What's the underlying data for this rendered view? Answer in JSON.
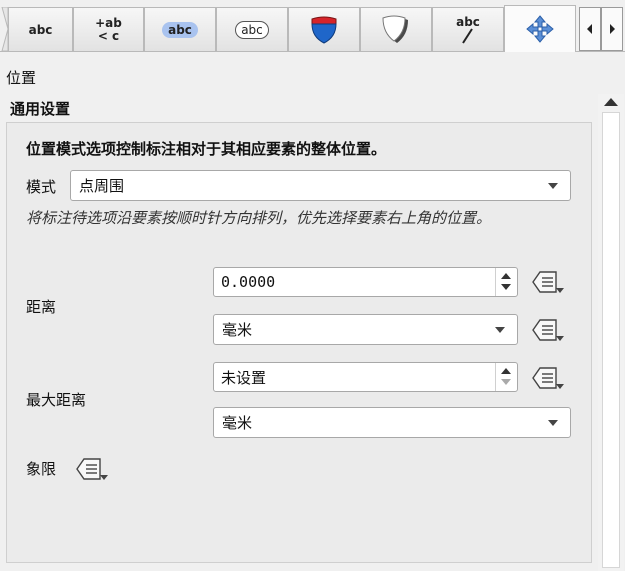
{
  "tabs": [
    {
      "name": "text",
      "label": "abc"
    },
    {
      "name": "formatting",
      "label_top": "+ab",
      "label_bottom": "< c"
    },
    {
      "name": "buffer",
      "label": "abc"
    },
    {
      "name": "mask",
      "label": "abc"
    },
    {
      "name": "background-shield",
      "icon": "interstate-shield-icon"
    },
    {
      "name": "shadow",
      "icon": "shadow-shield-icon"
    },
    {
      "name": "callouts",
      "label": "abc",
      "icon": "callout-line-icon"
    },
    {
      "name": "placement",
      "icon": "move-arrows-icon",
      "active": true
    }
  ],
  "section_title": "位置",
  "group_title": "通用设置",
  "description": "位置模式选项控制标注相对于其相应要素的整体位置。",
  "mode": {
    "label": "模式",
    "value": "点周围"
  },
  "hint": "将标注待选项沿要素按顺时针方向排列，优先选择要素右上角的位置。",
  "distance": {
    "label": "距离",
    "value": "0.0000",
    "unit": "毫米"
  },
  "max_distance": {
    "label": "最大距离",
    "value": "未设置",
    "unit": "毫米"
  },
  "quadrant": {
    "label": "象限"
  },
  "colors": {
    "accent_blue": "#1f66c9",
    "shield_red": "#d6242a",
    "buffer_fill": "#a9c3ef"
  }
}
